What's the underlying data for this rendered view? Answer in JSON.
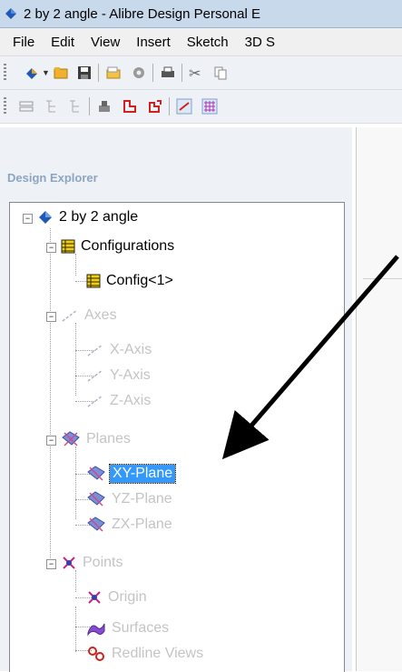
{
  "window": {
    "title": "2 by 2 angle - Alibre Design Personal E"
  },
  "menu": [
    "File",
    "Edit",
    "View",
    "Insert",
    "Sketch",
    "3D S"
  ],
  "explorer": {
    "label": "Design Explorer",
    "tree": {
      "root": "2 by 2 angle",
      "configurations": "Configurations",
      "config1": "Config<1>",
      "axes": "Axes",
      "x_axis": "X-Axis",
      "y_axis": "Y-Axis",
      "z_axis": "Z-Axis",
      "planes": "Planes",
      "xy_plane": "XY-Plane",
      "yz_plane": "YZ-Plane",
      "zx_plane": "ZX-Plane",
      "points": "Points",
      "origin": "Origin",
      "surfaces": "Surfaces",
      "redline": "Redline Views"
    }
  },
  "colors": {
    "selection": "#3399ff",
    "disabled_text": "#c4c4c4",
    "explorer_label": "#8da5c0"
  },
  "icons": [
    "app-icon",
    "new-icon",
    "open-icon",
    "save-icon",
    "folder-icon",
    "gear-icon",
    "print-icon",
    "cut-icon",
    "copy-icon",
    "plane-icon",
    "axis-icon",
    "point-icon",
    "configuration-icon",
    "surface-icon",
    "redline-icon"
  ]
}
